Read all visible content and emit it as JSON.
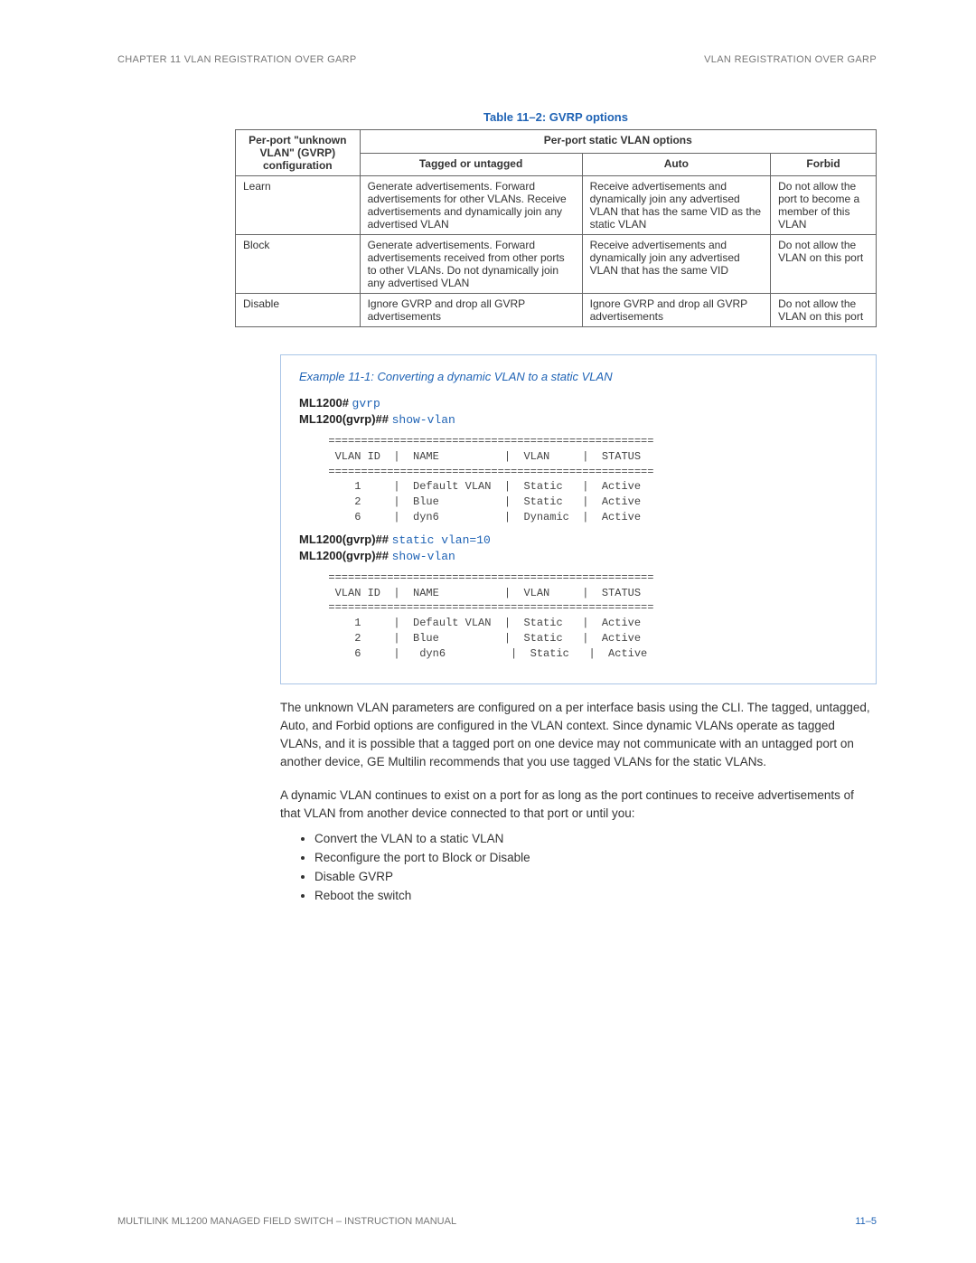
{
  "header": {
    "left": "CHAPTER 11  VLAN REGISTRATION OVER GARP",
    "right": "VLAN REGISTRATION OVER GARP"
  },
  "table": {
    "caption": "Table 11–2: GVRP options",
    "col_header_group": "Per-port static VLAN options",
    "row_header": "Per-port \"unknown VLAN\" (GVRP) configuration",
    "cols": [
      "Tagged or untagged",
      "Auto",
      "Forbid"
    ],
    "rows": [
      {
        "name": "Learn",
        "cells": [
          "Generate advertisements. Forward advertisements for other VLANs. Receive advertisements and dynamically join any advertised VLAN",
          "Receive advertisements and dynamically join any advertised VLAN that has the same VID as the static VLAN",
          "Do not allow the port to become a member of this VLAN"
        ]
      },
      {
        "name": "Block",
        "cells": [
          "Generate advertisements. Forward advertisements received from other ports to other VLANs. Do not dynamically join any advertised VLAN",
          "Receive advertisements and dynamically join any advertised VLAN that has the same VID",
          "Do not allow the VLAN on this port"
        ]
      },
      {
        "name": "Disable",
        "cells": [
          "Ignore GVRP and drop all GVRP advertisements",
          "Ignore GVRP and drop all GVRP advertisements",
          "Do not allow the VLAN on this port"
        ]
      }
    ]
  },
  "example": {
    "title": "Example 11-1: Converting a dynamic VLAN to a static VLAN",
    "lines": [
      {
        "prompt": "ML1200# ",
        "cmd": "gvrp"
      },
      {
        "prompt": "ML1200(gvrp)## ",
        "cmd": "show-vlan"
      }
    ],
    "output1": "  ==================================================\n   VLAN ID  |  NAME          |  VLAN     |  STATUS\n  ==================================================\n      1     |  Default VLAN  |  Static   |  Active\n      2     |  Blue          |  Static   |  Active\n      6     |  dyn6          |  Dynamic  |  Active",
    "lines2": [
      {
        "prompt": "ML1200(gvrp)## ",
        "cmd": "static vlan=10"
      },
      {
        "prompt": "ML1200(gvrp)## ",
        "cmd": "show-vlan"
      }
    ],
    "output2": "  ==================================================\n   VLAN ID  |  NAME          |  VLAN     |  STATUS\n  ==================================================\n      1     |  Default VLAN  |  Static   |  Active\n      2     |  Blue          |  Static   |  Active\n      6     |   dyn6          |  Static   |  Active"
  },
  "body": {
    "p1": "The unknown VLAN parameters are configured on a per interface basis using the CLI. The tagged, untagged, Auto, and Forbid options are configured in the VLAN context. Since dynamic VLANs operate as tagged VLANs, and it is possible that a tagged port on one device may not communicate with an untagged port on another device, GE Multilin recommends that you use tagged VLANs for the static VLANs.",
    "p2": "A dynamic VLAN continues to exist on a port for as long as the port continues to receive advertisements of that VLAN from another device connected to that port or until you:",
    "bullets": [
      "Convert the VLAN to a static VLAN",
      "Reconfigure the port to Block or Disable",
      "Disable GVRP",
      "Reboot the switch"
    ]
  },
  "footer": {
    "left": "MULTILINK ML1200 MANAGED FIELD SWITCH – INSTRUCTION MANUAL",
    "right": "11–5"
  }
}
